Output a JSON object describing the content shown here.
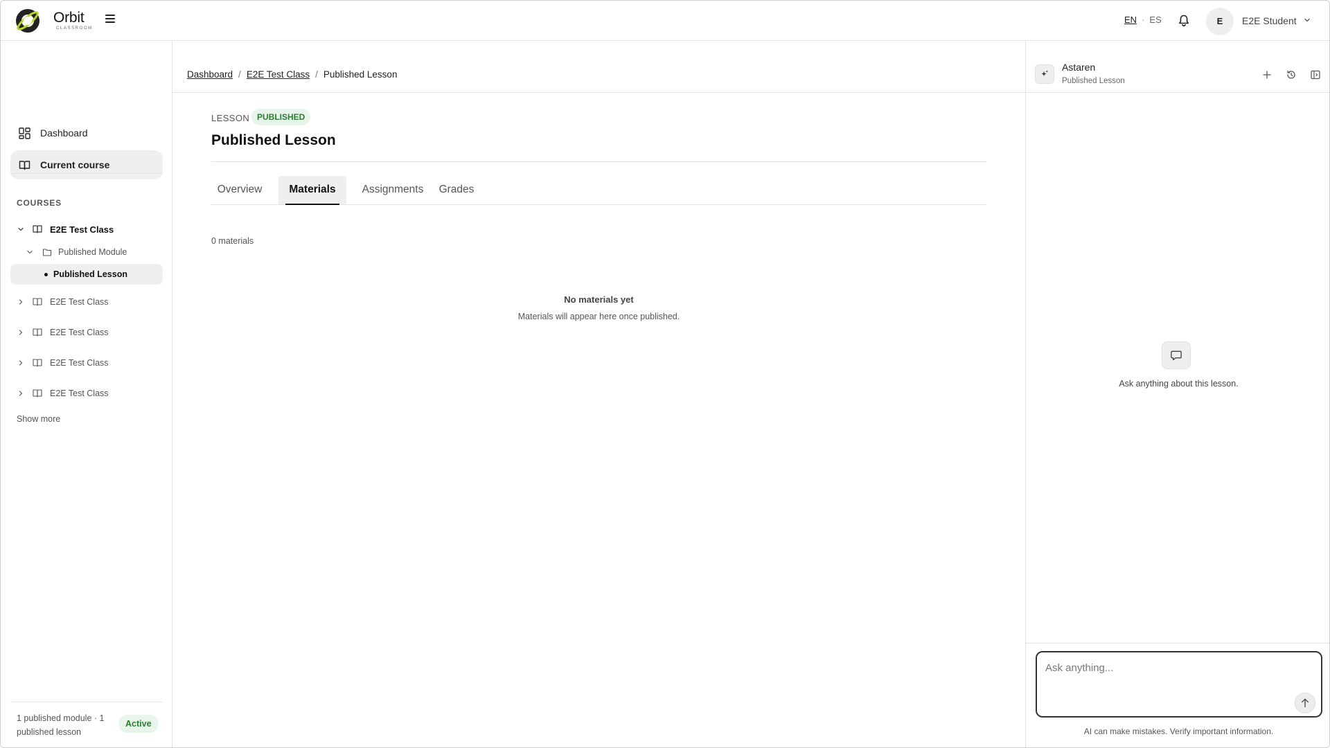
{
  "header": {
    "brand_name": "Orbit",
    "brand_sub": "CLASSROOM",
    "lang_active": "EN",
    "lang_other": "ES",
    "lang_sep": "·",
    "avatar_initial": "E",
    "user_name": "E2E Student"
  },
  "sidebar": {
    "nav": [
      {
        "label": "Dashboard",
        "icon": "dashboard-icon"
      },
      {
        "label": "Current course",
        "icon": "book-icon"
      }
    ],
    "courses_title": "COURSES",
    "tree": {
      "course": "E2E Test Class",
      "module": "Published Module",
      "lesson": "Published Lesson",
      "other_courses": [
        "E2E Test Class",
        "E2E Test Class",
        "E2E Test Class",
        "E2E Test Class"
      ]
    },
    "show_more": "Show more",
    "footer_text": "1 published module · 1 published lesson",
    "status_badge": "Active"
  },
  "main": {
    "breadcrumb": [
      "Dashboard",
      "E2E Test Class",
      "Published Lesson"
    ],
    "breadcrumb_sep": "/",
    "lesson_label": "LESSON",
    "status": "PUBLISHED",
    "title": "Published Lesson",
    "tabs": [
      "Overview",
      "Materials",
      "Assignments",
      "Grades"
    ],
    "selected_tab": "Materials",
    "count": "0 materials",
    "empty_title": "No materials yet",
    "empty_sub": "Materials will appear here once published."
  },
  "assistant": {
    "name": "Astaren",
    "context": "Published Lesson",
    "empty_text": "Ask anything about this lesson.",
    "input_placeholder": "Ask anything...",
    "disclaimer": "AI can make mistakes. Verify important information."
  },
  "colors": {
    "accent_green": "#2e7d32",
    "badge_bg": "#e6f4ea",
    "selected_bg": "#efefef"
  }
}
